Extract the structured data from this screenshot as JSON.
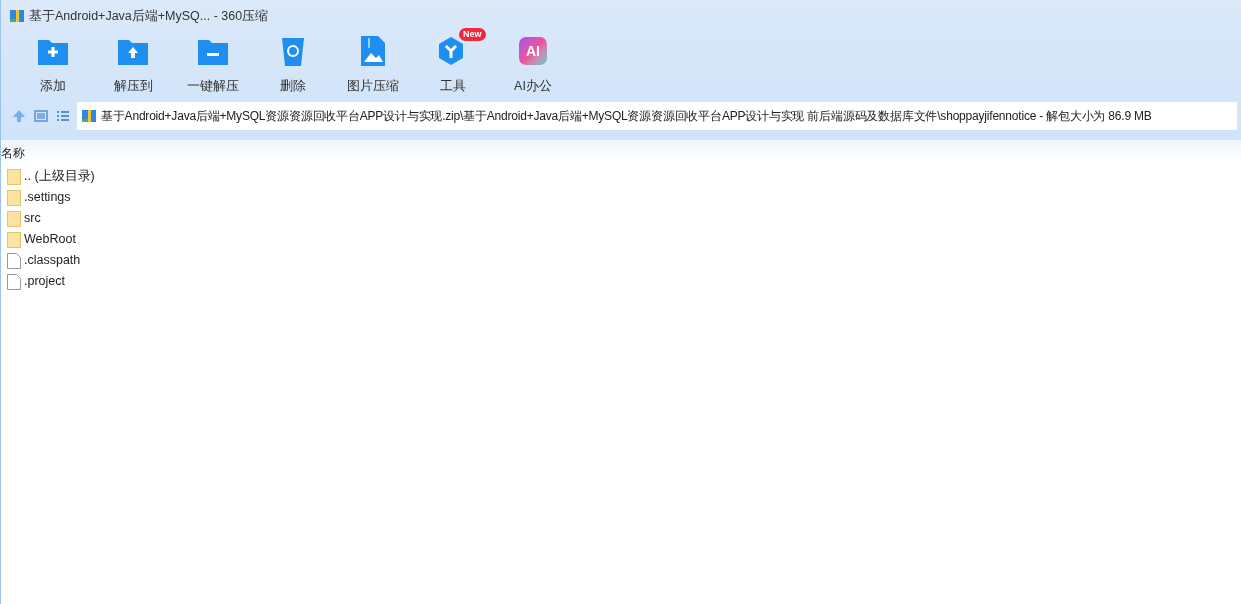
{
  "window": {
    "title": "基于Android+Java后端+MySQ... - 360压缩"
  },
  "toolbar": [
    {
      "kind": "add",
      "label": "添加"
    },
    {
      "kind": "extract",
      "label": "解压到"
    },
    {
      "kind": "oneclick",
      "label": "一键解压"
    },
    {
      "kind": "delete",
      "label": "删除"
    },
    {
      "kind": "image",
      "label": "图片压缩"
    },
    {
      "kind": "tools",
      "label": "工具",
      "badge": "New"
    },
    {
      "kind": "ai",
      "label": "AI办公",
      "icon_text": "AI"
    }
  ],
  "address": {
    "path": "基于Android+Java后端+MySQL资源资源回收平台APP设计与实现.zip\\基于Android+Java后端+MySQL资源资源回收平台APP设计与实现 前后端源码及数据库文件\\shoppayjifennotice - 解包大小为 86.9 MB"
  },
  "table": {
    "columns": [
      "名称"
    ],
    "rows": [
      {
        "kind": "folder",
        "name": ".. (上级目录)"
      },
      {
        "kind": "folder",
        "name": ".settings"
      },
      {
        "kind": "folder",
        "name": "src"
      },
      {
        "kind": "folder",
        "name": "WebRoot"
      },
      {
        "kind": "file",
        "name": ".classpath"
      },
      {
        "kind": "file",
        "name": ".project"
      }
    ]
  }
}
